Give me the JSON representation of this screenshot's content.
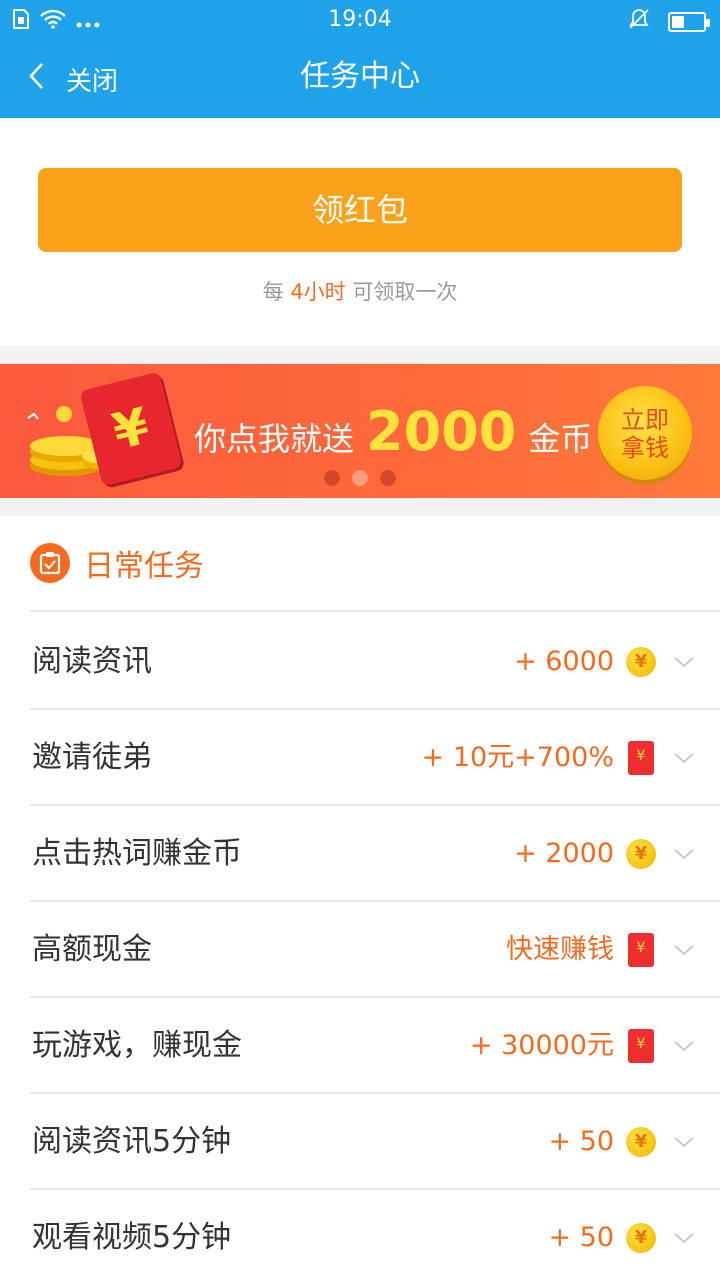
{
  "status": {
    "time": "19:04"
  },
  "nav": {
    "back_label": "关闭",
    "title": "任务中心"
  },
  "packet": {
    "button_label": "领红包",
    "note_prefix": "每",
    "note_highlight": "4小时",
    "note_suffix": "可领取一次"
  },
  "banner": {
    "text_before": "你点我就送",
    "amount": "2000",
    "text_after": "金币",
    "cta_line1": "立即",
    "cta_line2": "拿钱",
    "pkt_glyph": "¥"
  },
  "tasks": {
    "title": "日常任务",
    "items": [
      {
        "name": "阅读资讯",
        "reward": "+ 6000",
        "icon": "coin-icon"
      },
      {
        "name": "邀请徒弟",
        "reward": "+ 10元+700%",
        "icon": "red-packet-icon"
      },
      {
        "name": "点击热词赚金币",
        "reward": "+ 2000",
        "icon": "coin-icon"
      },
      {
        "name": "高额现金",
        "reward": "快速赚钱",
        "icon": "red-packet-icon"
      },
      {
        "name": "玩游戏，赚现金",
        "reward": "+ 30000元",
        "icon": "red-packet-icon"
      },
      {
        "name": "阅读资讯5分钟",
        "reward": "+ 50",
        "icon": "coin-icon"
      },
      {
        "name": "观看视频5分钟",
        "reward": "+ 50",
        "icon": "coin-icon"
      }
    ]
  },
  "colors": {
    "header": "#1ea3ea",
    "accent": "#f56a1c",
    "button": "#fba11a"
  },
  "battery_level": 0.4
}
